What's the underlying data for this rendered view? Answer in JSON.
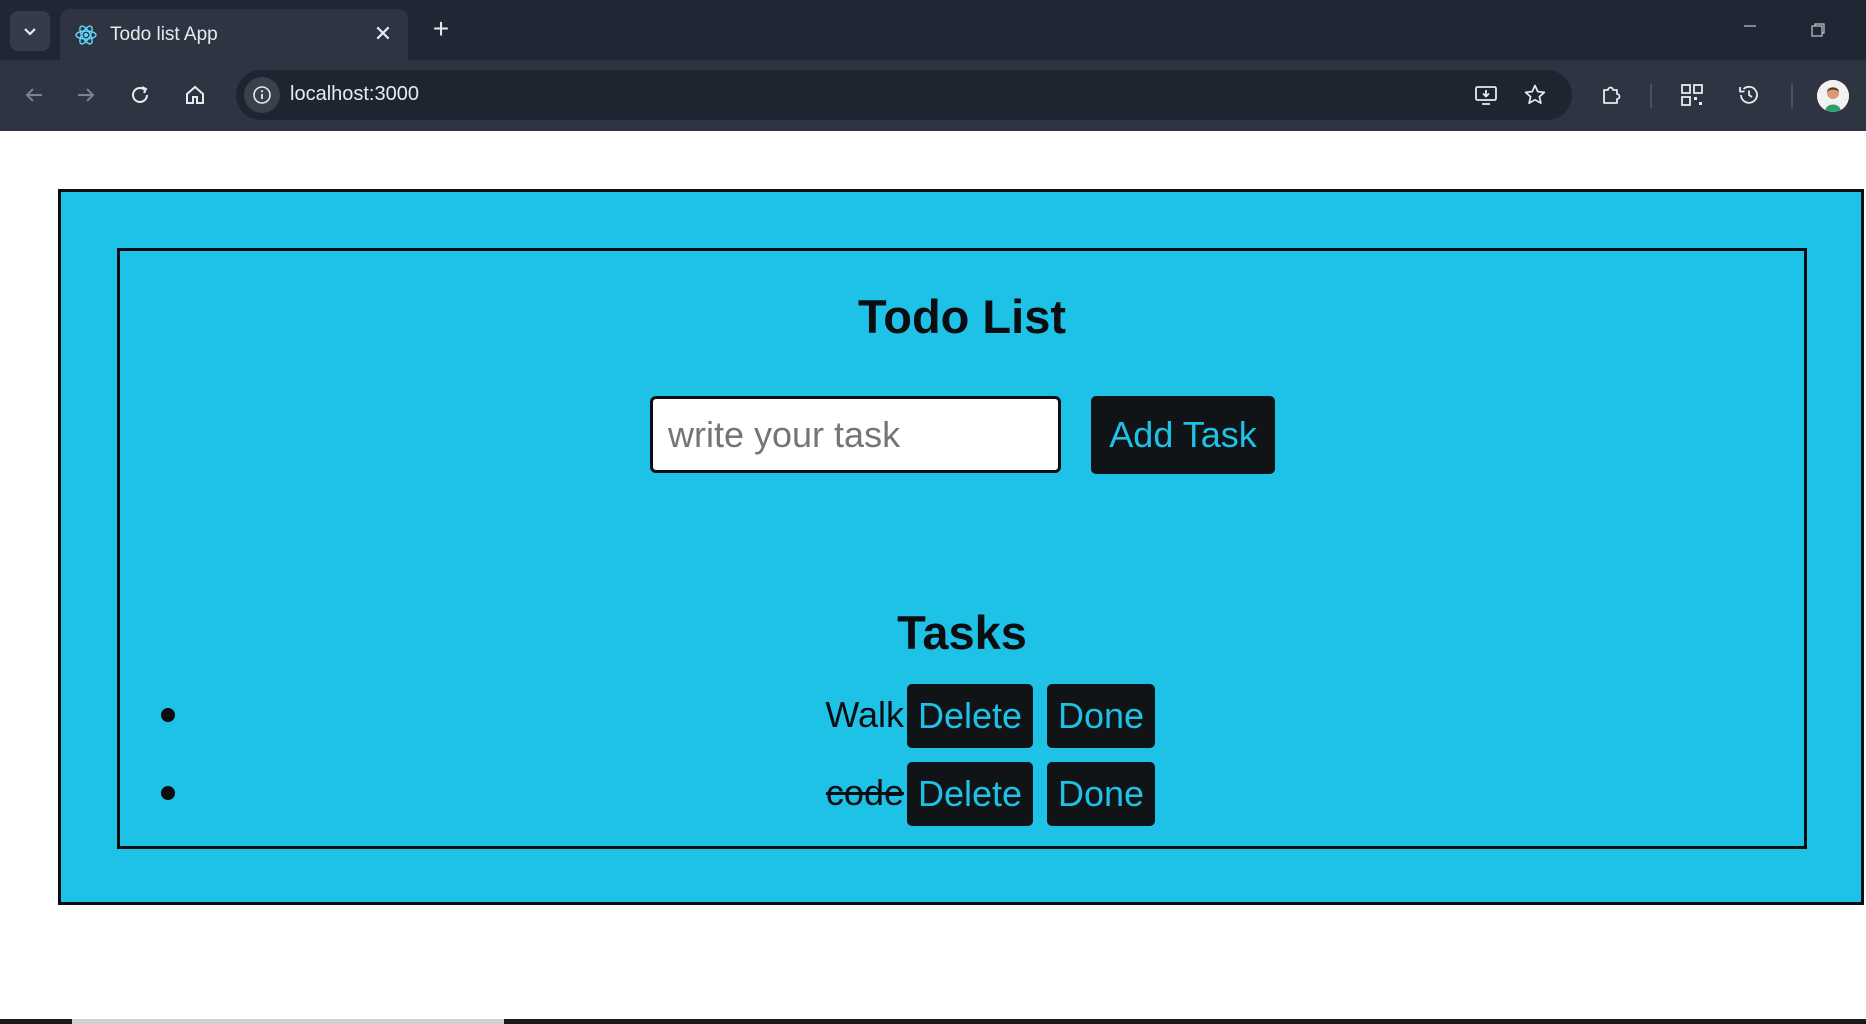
{
  "browser": {
    "tab_title": "Todo list App",
    "tab_close": "✕",
    "new_tab": "+",
    "url": "localhost:3000",
    "icons": {
      "tab_search": "chevron-down-icon",
      "favicon": "react-atom-icon",
      "back": "arrow-left-icon",
      "forward": "arrow-right-icon",
      "reload": "reload-icon",
      "home": "home-icon",
      "site_info": "info-icon",
      "install": "install-app-icon",
      "bookmark": "star-icon",
      "extensions": "puzzle-icon",
      "qr": "qr-code-icon",
      "history": "history-icon",
      "profile": "avatar"
    },
    "colors": {
      "tabstrip": "#202633",
      "toolbar": "#2e3442",
      "omnibox": "#1e2430"
    }
  },
  "app": {
    "title": "Todo List",
    "input": {
      "value": "",
      "placeholder": "write your task"
    },
    "add_button": "Add Task",
    "tasks_heading": "Tasks",
    "tasks": [
      {
        "text": "Walk",
        "done": false,
        "delete_label": "Delete",
        "done_label": "Done"
      },
      {
        "text": "code",
        "done": true,
        "delete_label": "Delete",
        "done_label": "Done"
      }
    ],
    "colors": {
      "background": "#1ec2e6",
      "button_bg": "#111416",
      "button_text": "#1ec2e6",
      "border": "#0b0d10"
    }
  }
}
